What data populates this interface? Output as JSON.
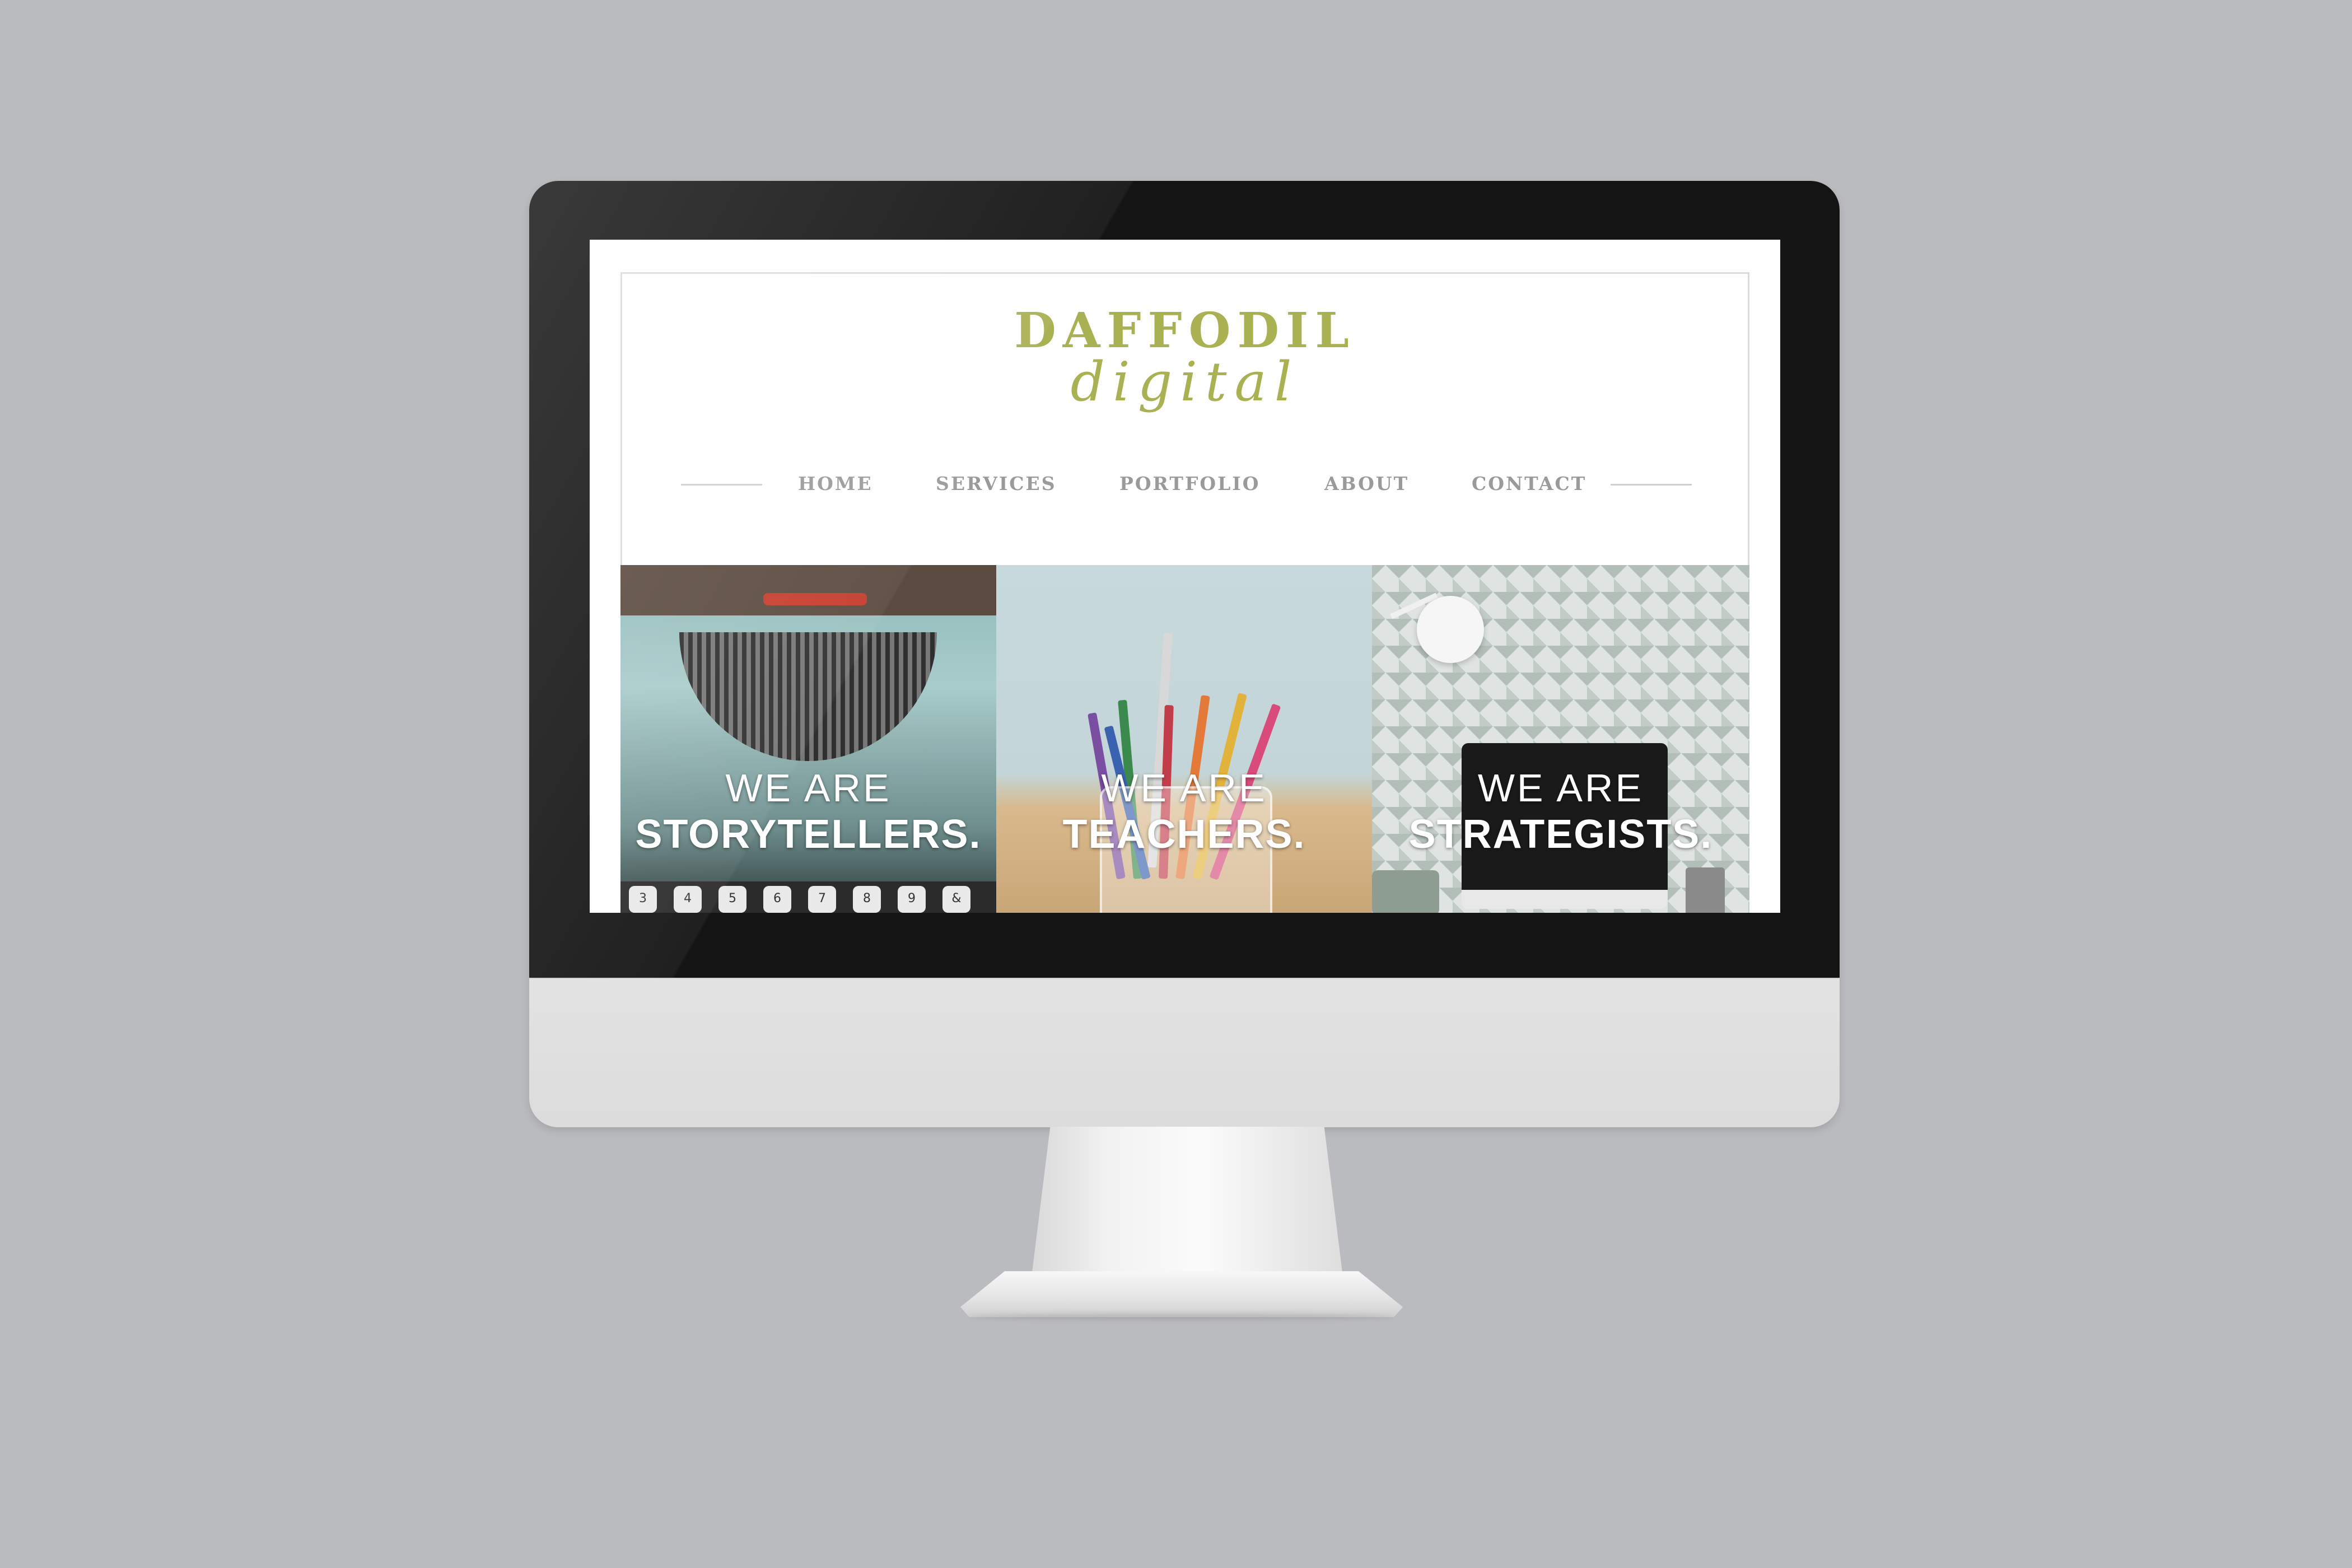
{
  "site": {
    "logo_top": "DAFFODIL",
    "logo_script": "digital",
    "brand_color": "#a9b153"
  },
  "nav": {
    "items": [
      {
        "label": "HOME"
      },
      {
        "label": "SERVICES"
      },
      {
        "label": "PORTFOLIO"
      },
      {
        "label": "ABOUT"
      },
      {
        "label": "CONTACT"
      }
    ]
  },
  "tiles": [
    {
      "line1": "WE ARE",
      "line2": "STORYTELLERS."
    },
    {
      "line1": "WE ARE",
      "line2": "TEACHERS."
    },
    {
      "line1": "WE ARE",
      "line2": "STRATEGISTS."
    }
  ],
  "keys": [
    "3",
    "4",
    "5",
    "6",
    "7",
    "8",
    "9",
    "&"
  ]
}
